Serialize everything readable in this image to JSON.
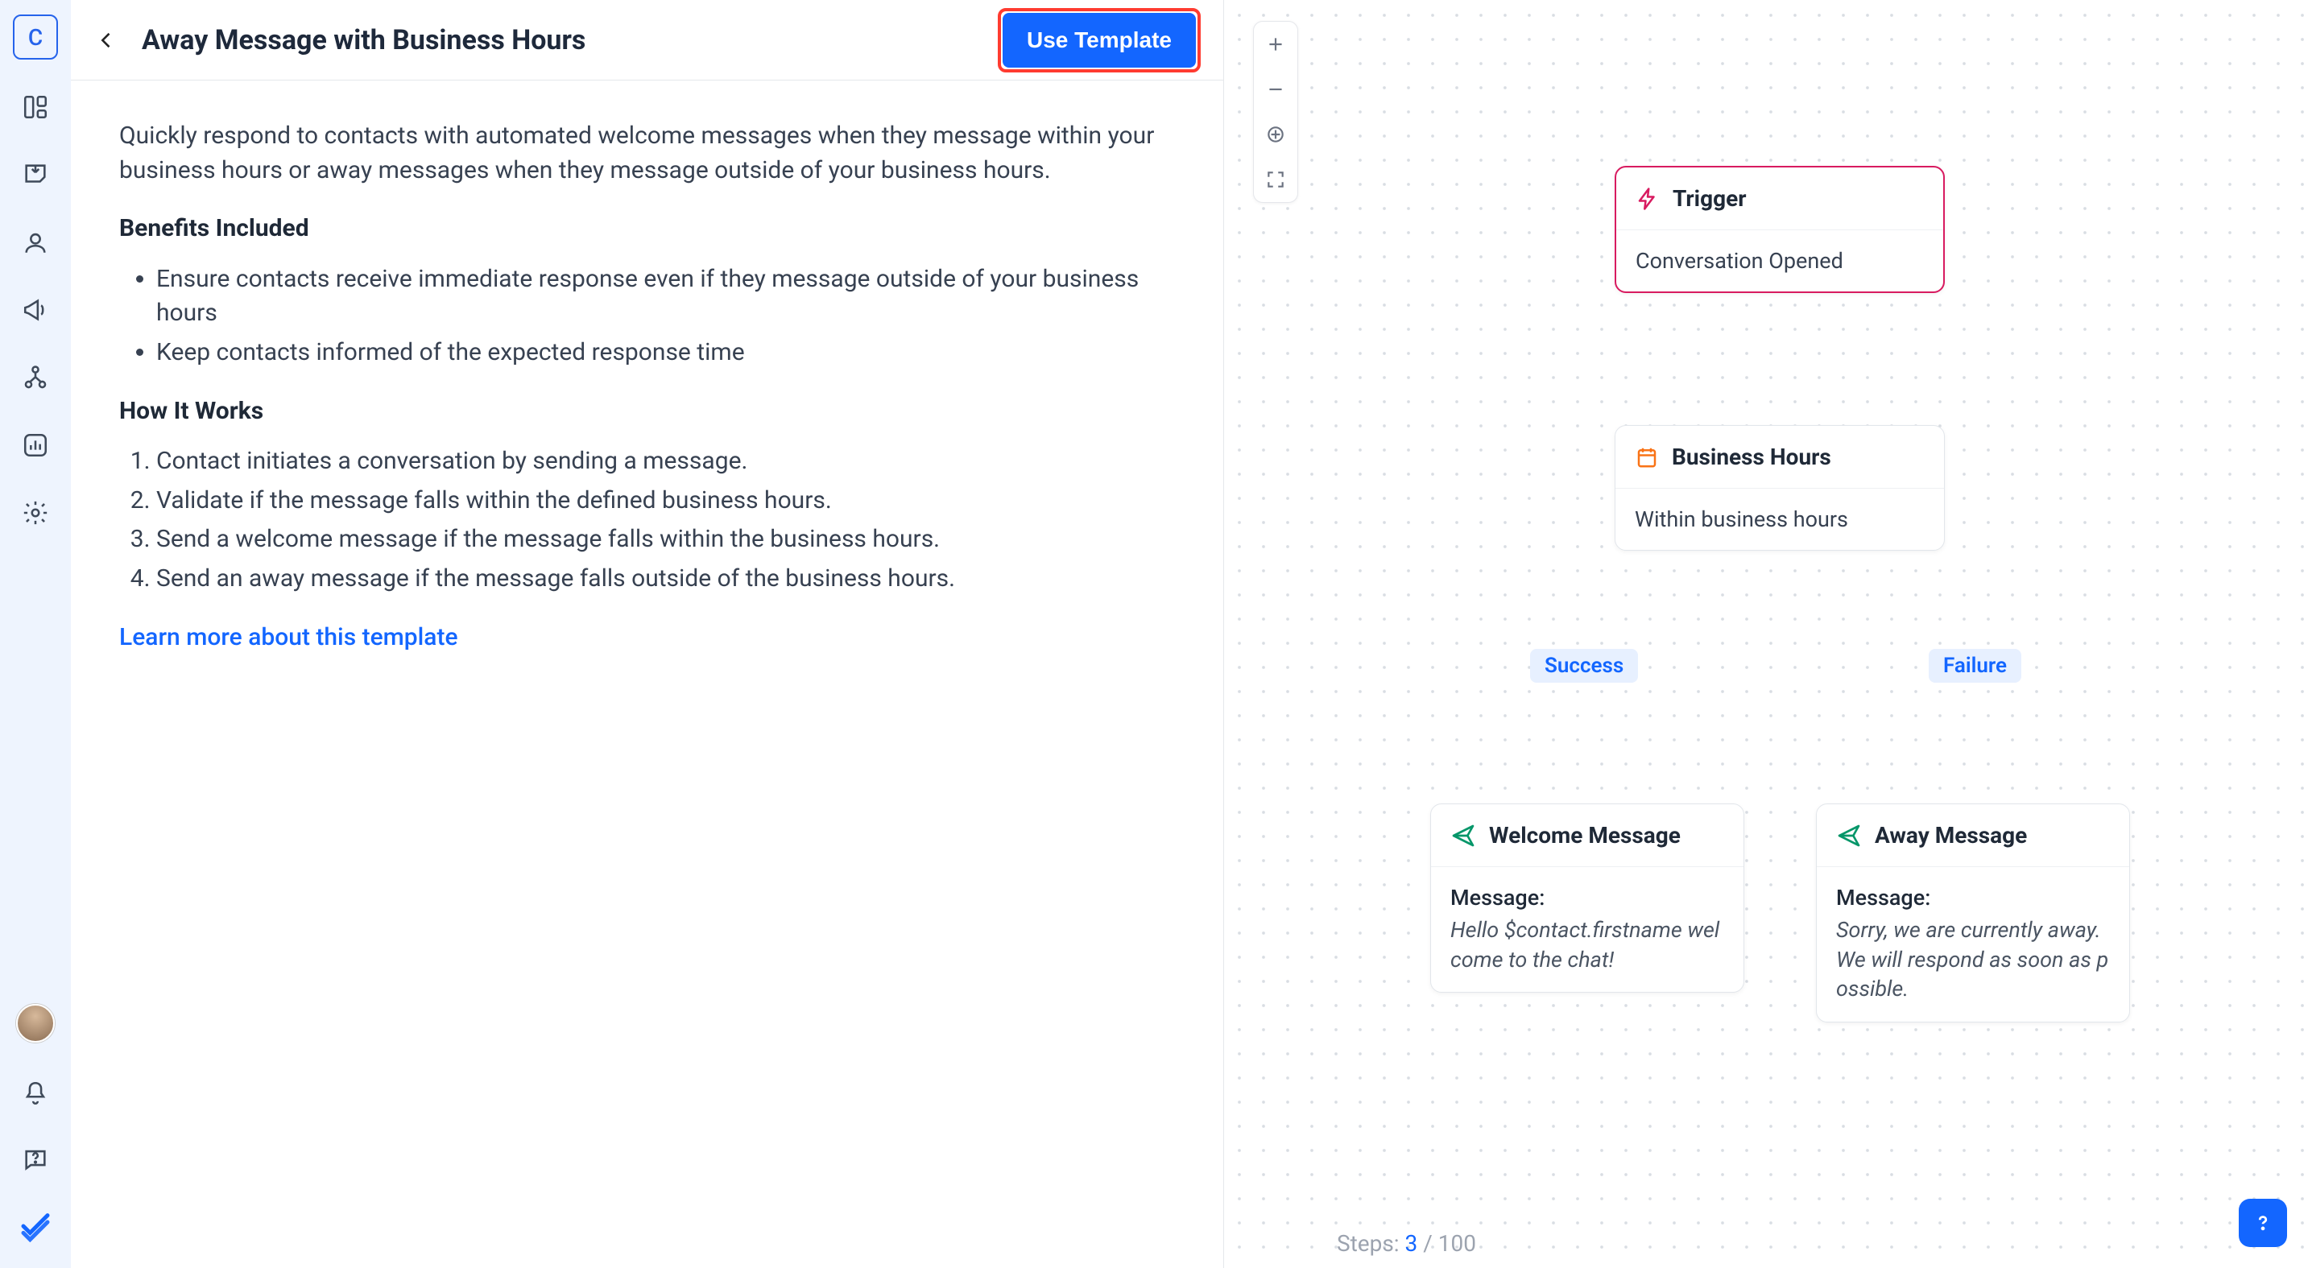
{
  "sidebar": {
    "app_letter": "C"
  },
  "header": {
    "title": "Away Message with Business Hours",
    "use_template": "Use Template"
  },
  "body": {
    "intro": "Quickly respond to contacts with automated welcome messages when they message within your business hours or away messages when they message outside of your business hours.",
    "benefits_heading": "Benefits Included",
    "benefits": [
      "Ensure contacts receive immediate response even if they message outside of your business hours",
      "Keep contacts informed of the expected response time"
    ],
    "how_heading": "How It Works",
    "how_steps": [
      "Contact initiates a conversation by sending a message.",
      "Validate if the message falls within the defined business hours.",
      "Send a welcome message if the message falls within the business hours.",
      "Send an away message if the message falls outside of the business hours."
    ],
    "learn_more": "Learn more about this template"
  },
  "canvas": {
    "steps_prefix": "Steps: ",
    "steps_current": "3",
    "steps_sep": " / ",
    "steps_total": "100",
    "branch_success": "Success",
    "branch_failure": "Failure",
    "nodes": {
      "trigger": {
        "title": "Trigger",
        "body": "Conversation Opened"
      },
      "hours": {
        "title": "Business Hours",
        "body": "Within business hours"
      },
      "welcome": {
        "title": "Welcome Message",
        "msg_label": "Message:",
        "msg_text": "Hello $contact.firstname welcome to the chat!"
      },
      "away": {
        "title": "Away Message",
        "msg_label": "Message:",
        "msg_text": "Sorry, we are currently away. We will respond as soon as possible."
      }
    }
  }
}
